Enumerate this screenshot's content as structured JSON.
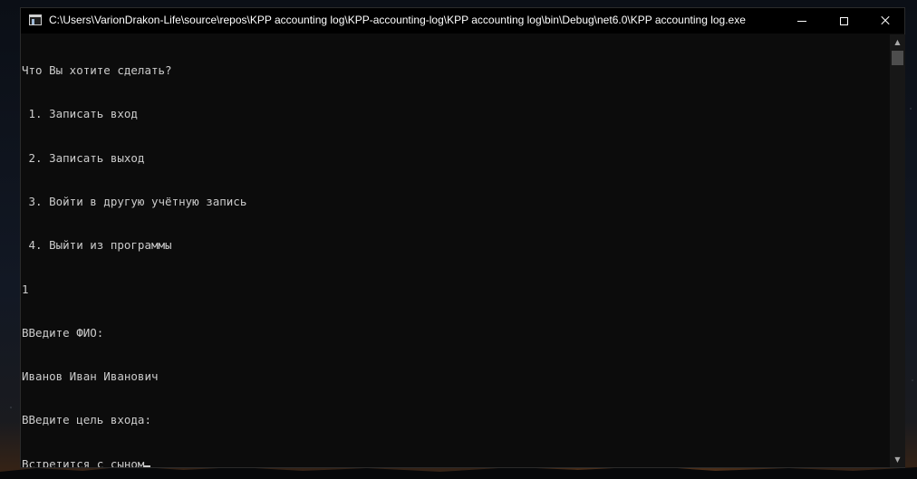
{
  "window": {
    "title": "C:\\Users\\VarionDrakon-Life\\source\\repos\\KPP accounting log\\KPP-accounting-log\\KPP accounting log\\bin\\Debug\\net6.0\\KPP accounting log.exe",
    "icons": {
      "app": "console-app-icon",
      "minimize": "minimize-icon",
      "maximize": "maximize-icon",
      "close": "close-icon",
      "scroll_up": "scroll-up-arrow-icon",
      "scroll_down": "scroll-down-arrow-icon"
    },
    "scroll_up_glyph": "▲",
    "scroll_down_glyph": "▼"
  },
  "console": {
    "lines": [
      "Что Вы хотите сделать?",
      " 1. Записать вход",
      " 2. Записать выход",
      " 3. Войти в другую учётную запись",
      " 4. Выйти из программы",
      "1",
      "ВВедите ФИО:",
      "Иванов Иван Иванович",
      "ВВедите цель входа:"
    ],
    "current_input": "Встретится с сыном"
  },
  "colors": {
    "console_bg": "#0c0c0c",
    "console_text": "#cccccc",
    "titlebar_bg": "#000000",
    "title_text": "#ffffff"
  }
}
